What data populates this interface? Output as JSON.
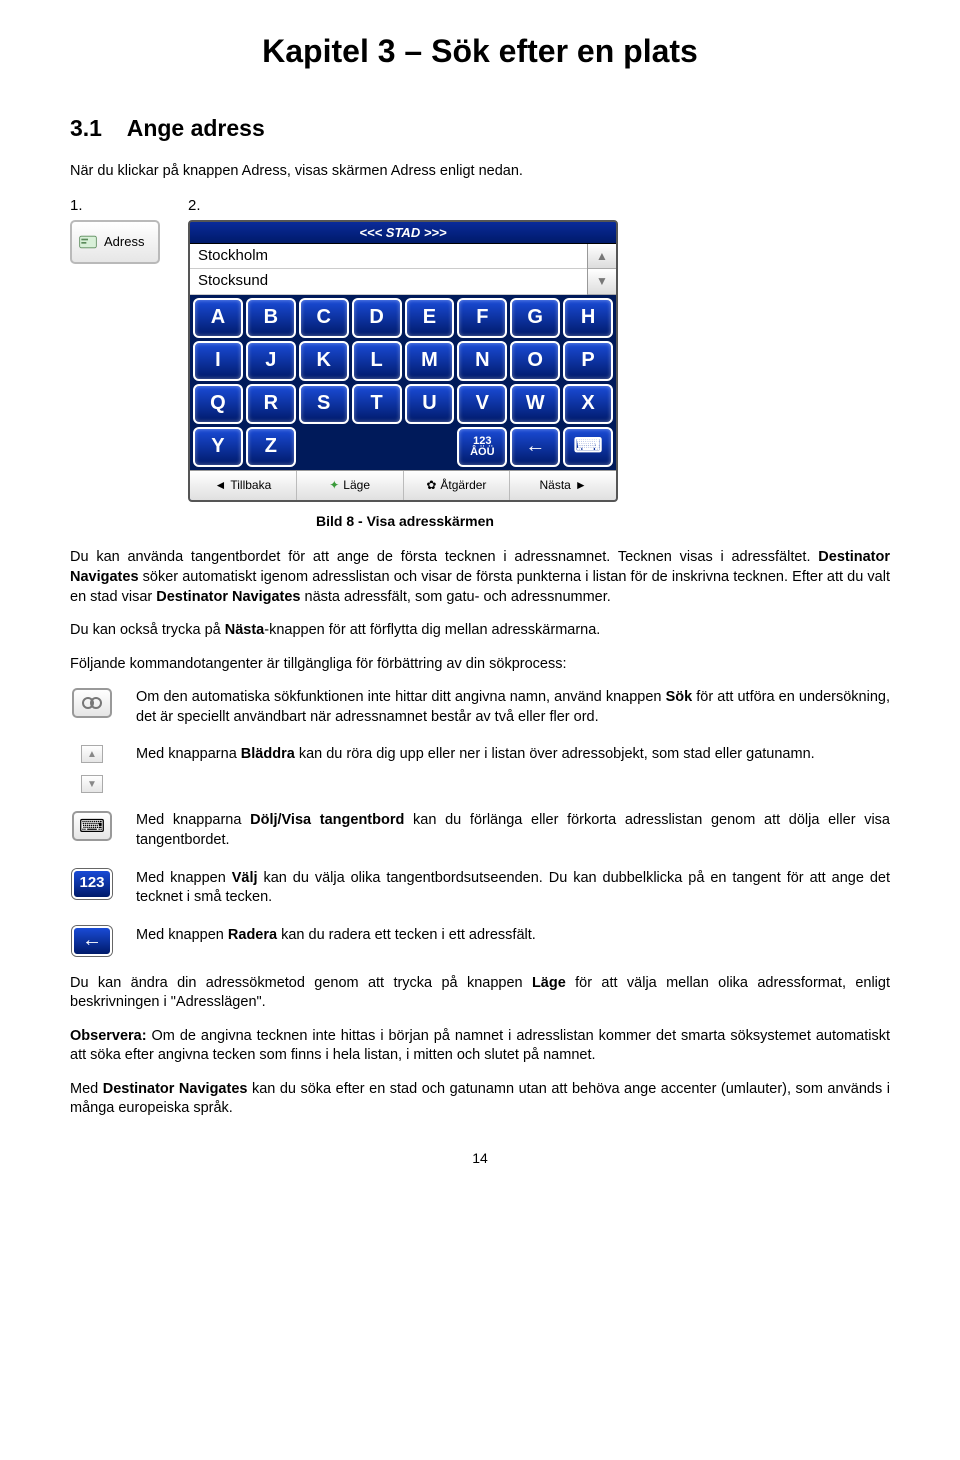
{
  "chapterTitle": "Kapitel 3 – Sök efter en plats",
  "sectionNumber": "3.1",
  "sectionTitle": "Ange adress",
  "intro": "När du klickar på knappen Adress, visas skärmen Adress enligt nedan.",
  "figNums": {
    "one": "1.",
    "two": "2."
  },
  "adressBtnLabel": "Adress",
  "device": {
    "header": "<<< STAD >>>",
    "list": [
      "Stockholm",
      "Stocksund"
    ],
    "rows": [
      [
        "A",
        "B",
        "C",
        "D",
        "E",
        "F",
        "G",
        "H"
      ],
      [
        "I",
        "J",
        "K",
        "L",
        "M",
        "N",
        "O",
        "P"
      ],
      [
        "Q",
        "R",
        "S",
        "T",
        "U",
        "V",
        "W",
        "X"
      ]
    ],
    "lastRow": {
      "Y": "Y",
      "Z": "Z",
      "k123": "123",
      "kAOU": "ÅÖÜ",
      "back": "←",
      "kbd": "⌨"
    },
    "bottom": [
      "Tillbaka",
      "Läge",
      "Åtgärder",
      "Nästa"
    ]
  },
  "caption": "Bild 8 - Visa adresskärmen",
  "p1a": "Du kan använda tangentbordet för att ange de första tecknen i adressnamnet. Tecknen visas i adressfältet. ",
  "p1b": "Destinator Navigates",
  "p1c": " söker automatiskt igenom adresslistan och visar de första punkterna i listan för de inskrivna tecknen. Efter att du valt en stad visar ",
  "p1d": "Destinator Navigates",
  "p1e": " nästa adressfält, som gatu- och adressnummer.",
  "p2a": "Du kan också trycka på ",
  "p2b": "Nästa",
  "p2c": "-knappen för att förflytta dig mellan adresskärmarna.",
  "p3": "Följande kommandotangenter är tillgängliga för förbättring av din sökprocess:",
  "rows": {
    "r1a": "Om den automatiska sökfunktionen inte hittar ditt angivna namn, använd knappen ",
    "r1b": "Sök",
    "r1c": " för att utföra en undersökning, det är speciellt användbart när adressnamnet består av två eller fler ord.",
    "r2a": "Med knapparna ",
    "r2b": "Bläddra",
    "r2c": " kan du röra dig upp eller ner i listan över adressobjekt, som stad eller gatunamn.",
    "r3a": "Med knapparna ",
    "r3b": "Dölj/Visa tangentbord",
    "r3c": " kan du förlänga eller förkorta adresslistan genom att dölja eller visa tangentbordet.",
    "r4a": "Med knappen ",
    "r4b": "Välj",
    "r4c": " kan du välja olika tangentbordsutseenden. Du kan dubbelklicka på en tangent för att ange det tecknet i små tecken.",
    "r5a": "Med knappen ",
    "r5b": "Radera",
    "r5c": " kan du radera ett tecken i ett adressfält."
  },
  "p4a": "Du kan ändra din adressökmetod genom att trycka på knappen ",
  "p4b": "Läge",
  "p4c": " för att välja mellan olika adressformat, enligt beskrivningen i \"Adresslägen\".",
  "p5a": "Observera:",
  "p5b": " Om de angivna tecknen inte hittas i början på namnet i adresslistan kommer det smarta söksystemet automatiskt att söka efter angivna tecken som finns i hela listan, i mitten och slutet på namnet.",
  "p6a": "Med ",
  "p6b": "Destinator Navigates",
  "p6c": " kan du söka efter en stad och gatunamn utan att behöva ange accenter (umlauter), som används i många europeiska språk.",
  "pageNum": "14",
  "icons": {
    "num123": "123",
    "backArrow": "←",
    "kbd": "⌨"
  }
}
